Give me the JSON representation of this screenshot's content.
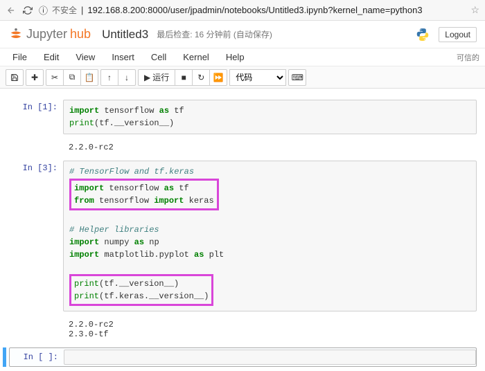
{
  "browser": {
    "insecure_label": "不安全",
    "url": "192.168.8.200:8000/user/jpadmin/notebooks/Untitled3.ipynb?kernel_name=python3"
  },
  "header": {
    "logo_pre": "Jupyter",
    "logo_hub": "hub",
    "title": "Untitled3",
    "checkpoint": "最后检查: 16 分钟前 (自动保存)",
    "logout": "Logout"
  },
  "menubar": {
    "items": [
      "File",
      "Edit",
      "View",
      "Insert",
      "Cell",
      "Kernel",
      "Help"
    ],
    "trusted": "可信的"
  },
  "toolbar": {
    "run_label": "运行",
    "cell_type": "代码"
  },
  "cells": [
    {
      "prompt": "In  [1]:",
      "code_html": "<span class='kw'>import</span> tensorflow <span class='kw'>as</span> tf\n<span class='bu'>print</span>(tf.__version__)",
      "output": "2.2.0-rc2"
    },
    {
      "prompt": "In  [3]:",
      "code_html": "<span class='cm'># TensorFlow and tf.keras</span>\n<div class='highlight-box'><span class='kw'>import</span> tensorflow <span class='kw'>as</span> tf\n<span class='kw'>from</span> tensorflow <span class='kw'>import</span> keras</div>\n\n<span class='cm'># Helper libraries</span>\n<span class='kw'>import</span> numpy <span class='kw'>as</span> np\n<span class='kw'>import</span> matplotlib.pyplot <span class='kw'>as</span> plt\n\n<div class='highlight-box'><span class='bu'>print</span>(tf.__version__)\n<span class='bu'>print</span>(tf.keras.__version__)</div>",
      "output": "2.2.0-rc2\n2.3.0-tf"
    },
    {
      "prompt": "In  [ ]:",
      "code_html": "",
      "output": null,
      "selected": true
    }
  ]
}
